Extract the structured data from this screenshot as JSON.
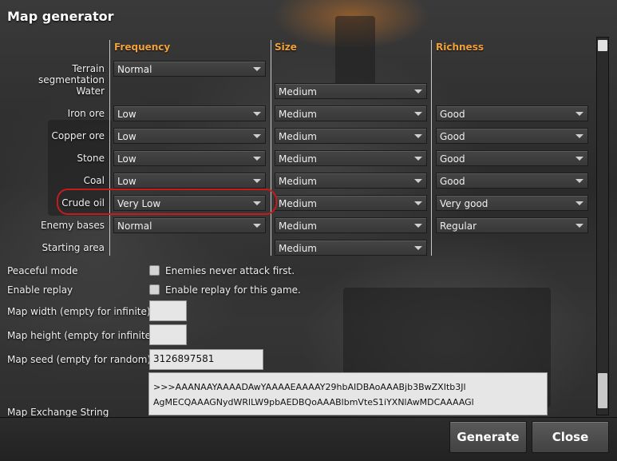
{
  "window": {
    "title": "Map generator"
  },
  "columns": {
    "frequency": "Frequency",
    "size": "Size",
    "richness": "Richness"
  },
  "rows": [
    {
      "label": "Terrain segmentation",
      "frequency": "Normal",
      "size": null,
      "richness": null
    },
    {
      "label": "Water",
      "frequency": null,
      "size": "Medium",
      "richness": null
    },
    {
      "label": "Iron ore",
      "frequency": "Low",
      "size": "Medium",
      "richness": "Good"
    },
    {
      "label": "Copper ore",
      "frequency": "Low",
      "size": "Medium",
      "richness": "Good"
    },
    {
      "label": "Stone",
      "frequency": "Low",
      "size": "Medium",
      "richness": "Good"
    },
    {
      "label": "Coal",
      "frequency": "Low",
      "size": "Medium",
      "richness": "Good"
    },
    {
      "label": "Crude oil",
      "frequency": "Very Low",
      "size": "Medium",
      "richness": "Very good"
    },
    {
      "label": "Enemy bases",
      "frequency": "Normal",
      "size": "Medium",
      "richness": "Regular"
    },
    {
      "label": "Starting area",
      "frequency": null,
      "size": "Medium",
      "richness": null
    }
  ],
  "options": {
    "peaceful_mode": {
      "label": "Peaceful mode",
      "checkbox_text": "Enemies never attack first.",
      "checked": false
    },
    "enable_replay": {
      "label": "Enable replay",
      "checkbox_text": "Enable replay for this game.",
      "checked": false
    },
    "map_width": {
      "label": "Map width (empty for infinite):",
      "value": ""
    },
    "map_height": {
      "label": "Map height (empty for infinite):",
      "value": ""
    },
    "map_seed": {
      "label": "Map seed (empty for random):",
      "value": "3126897581"
    },
    "exchange": {
      "label": "Map Exchange String",
      "lines": [
        ">>>AAANAAYAAAADAwYAAAAEAAAAY29hbAIDBAoAAABjb3BwZXItb3Jl",
        "AgMECQAAAGNydWRlLW9pbAEDBQoAAABlbmVteS1iYXNlAwMDCAAAAGl"
      ]
    }
  },
  "buttons": {
    "generate": "Generate",
    "close": "Close"
  },
  "colors": {
    "column_header": "#f2a23a",
    "highlight": "#c21c1c"
  }
}
